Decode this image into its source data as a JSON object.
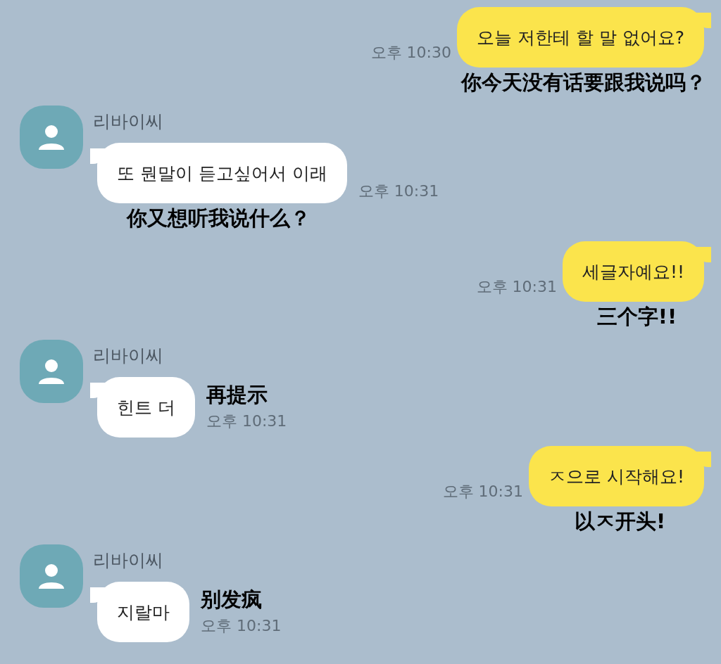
{
  "messages": [
    {
      "kind": "sent",
      "text": "오늘 저한테 할 말 없어요?",
      "time": "오후 10:30",
      "translation": "你今天没有话要跟我说吗？"
    },
    {
      "kind": "received",
      "sender": "리바이씨",
      "text": "또 뭔말이 듣고싶어서 이래",
      "time": "오후 10:31",
      "translation": "你又想听我说什么？"
    },
    {
      "kind": "sent",
      "text": "세글자예요!!",
      "time": "오후 10:31",
      "translation": "三个字!!"
    },
    {
      "kind": "received-inline",
      "sender": "리바이씨",
      "text": "힌트 더",
      "time": "오후 10:31",
      "translation": "再提示"
    },
    {
      "kind": "sent",
      "text": "ㅈ으로 시작해요!",
      "time": "오후 10:31",
      "translation": "以ㅈ开头!"
    },
    {
      "kind": "received-inline",
      "sender": "리바이씨",
      "text": "지랄마",
      "time": "오후 10:31",
      "translation": "别发疯"
    }
  ]
}
